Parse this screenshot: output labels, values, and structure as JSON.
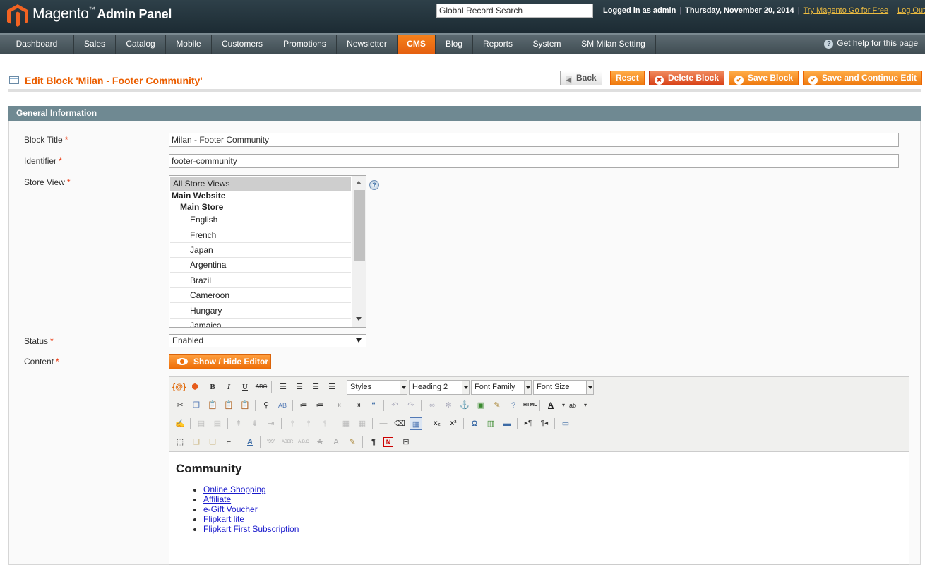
{
  "header": {
    "logo_brand": "Magento",
    "logo_product": "Admin Panel",
    "search_placeholder": "Global Record Search",
    "logged_in": "Logged in as admin",
    "date": "Thursday, November 20, 2014",
    "try_link": "Try Magento Go for Free",
    "logout_link": "Log Out"
  },
  "nav": {
    "items": [
      "Dashboard",
      "Sales",
      "Catalog",
      "Mobile",
      "Customers",
      "Promotions",
      "Newsletter",
      "CMS",
      "Blog",
      "Reports",
      "System",
      "SM Milan Setting"
    ],
    "active": "CMS",
    "help": "Get help for this page"
  },
  "page": {
    "title": "Edit Block 'Milan - Footer Community'",
    "buttons": {
      "back": "Back",
      "reset": "Reset",
      "delete": "Delete Block",
      "save": "Save Block",
      "save_continue": "Save and Continue Edit"
    }
  },
  "section": {
    "title": "General Information"
  },
  "form": {
    "block_title_label": "Block Title",
    "block_title_value": "Milan - Footer Community",
    "identifier_label": "Identifier",
    "identifier_value": "footer-community",
    "store_view_label": "Store View",
    "store_view": {
      "selected": "All Store Views",
      "website": "Main Website",
      "store": "Main Store",
      "views": [
        "English",
        "French",
        "Japan",
        "Argentina",
        "Brazil",
        "Cameroon",
        "Hungary",
        "Jamaica"
      ]
    },
    "status_label": "Status",
    "status_value": "Enabled",
    "content_label": "Content",
    "required_mark": "*"
  },
  "editor": {
    "toggle_button": "Show / Hide Editor",
    "selects": {
      "styles": "Styles",
      "format": "Heading 2",
      "font_family": "Font Family",
      "font_size": "Font Size"
    },
    "content": {
      "heading": "Community",
      "links": [
        "Online Shopping",
        "Affiliate",
        "e-Gift Voucher",
        "Flipkart lite",
        "Flipkart First Subscription"
      ]
    }
  },
  "colors": {
    "accent": "#eb5e00",
    "header_bg": "#263840",
    "section_bg": "#6f8992",
    "link_blue": "#1a1acc"
  }
}
